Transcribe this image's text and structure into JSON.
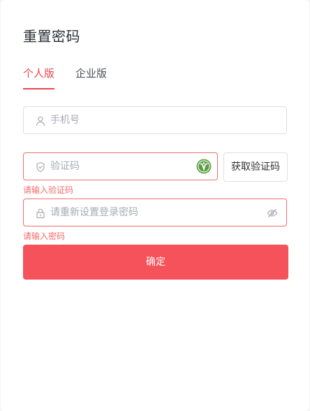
{
  "page": {
    "title": "重置密码"
  },
  "tabs": [
    {
      "label": "个人版",
      "active": true
    },
    {
      "label": "企业版",
      "active": false
    }
  ],
  "form": {
    "phone": {
      "placeholder": "手机号",
      "value": ""
    },
    "code": {
      "placeholder": "验证码",
      "value": "",
      "error": "请输入验证码"
    },
    "get_code_label": "获取验证码",
    "password": {
      "placeholder": "请重新设置登录密码",
      "value": "",
      "error": "请输入密码"
    },
    "submit_label": "确定"
  },
  "colors": {
    "accent": "#e8474f",
    "error": "#f56c6c",
    "button": "#f5525b",
    "border": "#dcdfe6"
  },
  "icons": {
    "phone": "user-icon",
    "code": "shield-icon",
    "password": "lock-icon",
    "eye": "eye-off-icon",
    "badge": "verification-badge-icon"
  }
}
